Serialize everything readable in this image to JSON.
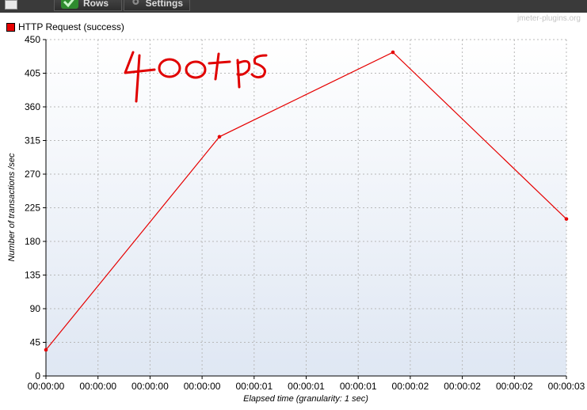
{
  "toolbar": {
    "tabs": [
      {
        "label": "Rows",
        "icon": "checkmark-icon"
      },
      {
        "label": "Settings",
        "icon": "gear-icon"
      }
    ]
  },
  "watermark": "jmeter-plugins.org",
  "annotation": "400tps",
  "colors": {
    "series": "#e60000",
    "plot_bg_top": "#ffffff",
    "plot_bg_bottom": "#dfe7f3",
    "grid": "#b8b8b8"
  },
  "chart_data": {
    "type": "line",
    "title": "",
    "xlabel": "Elapsed time (granularity: 1 sec)",
    "ylabel": "Number of transactions /sec",
    "legend_position": "top-left",
    "grid": true,
    "ylim": [
      0,
      450
    ],
    "yticks": [
      0,
      45,
      90,
      135,
      180,
      225,
      270,
      315,
      360,
      405,
      450
    ],
    "xlim": [
      0,
      3
    ],
    "xtick_labels": [
      "00:00:00",
      "00:00:00",
      "00:00:00",
      "00:00:00",
      "00:00:01",
      "00:00:01",
      "00:00:01",
      "00:00:02",
      "00:00:02",
      "00:00:02",
      "00:00:03"
    ],
    "series": [
      {
        "name": "HTTP Request (success)",
        "x": [
          0,
          1,
          2,
          3
        ],
        "y": [
          35,
          320,
          433,
          210
        ]
      }
    ]
  }
}
